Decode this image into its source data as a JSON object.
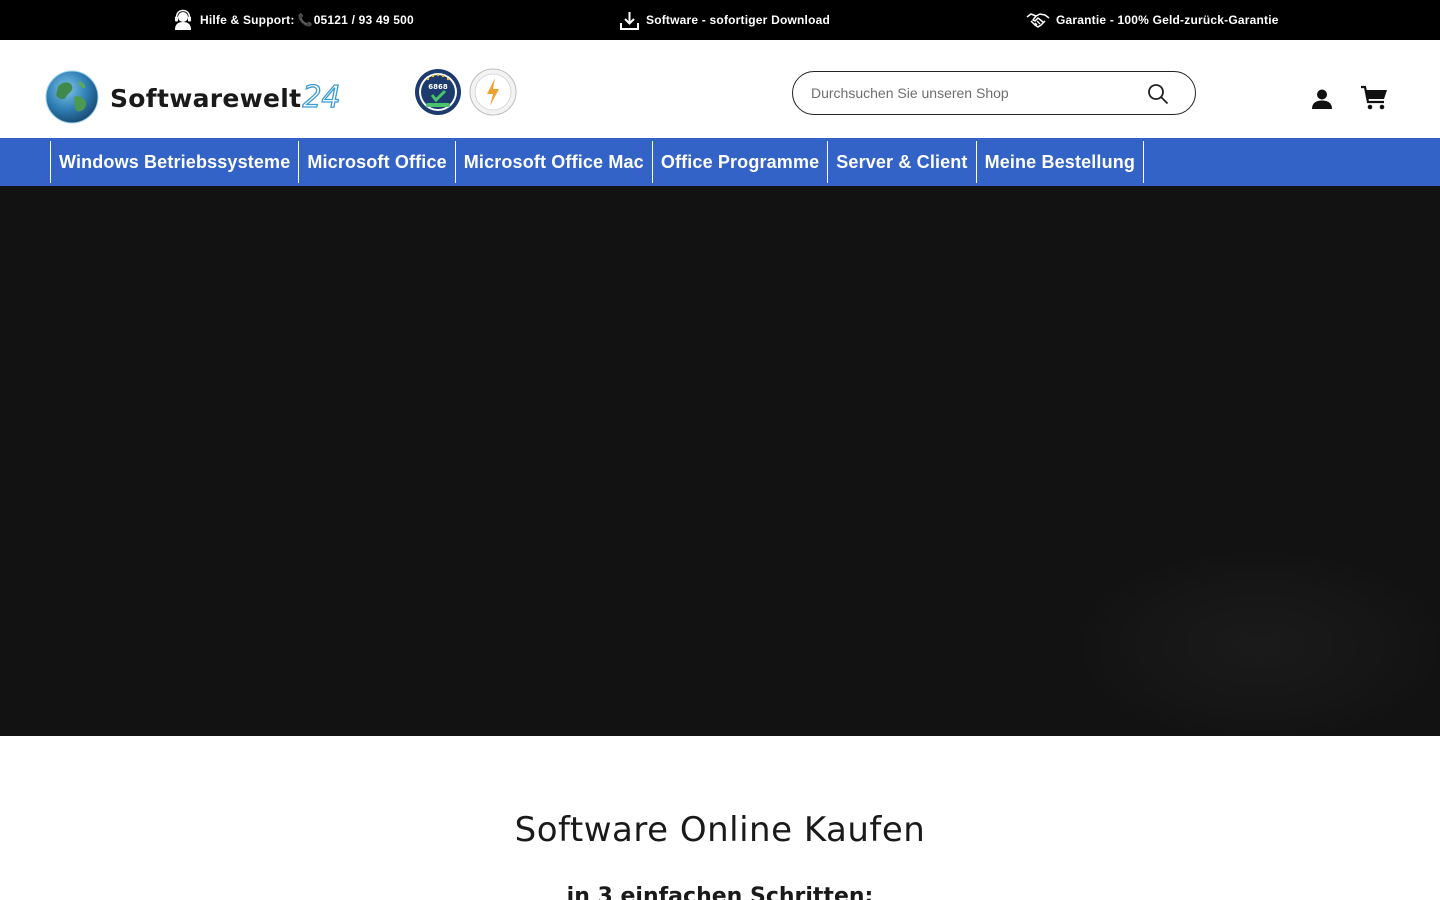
{
  "topbar": {
    "support_label": "Hilfe & Support:",
    "support_phone": "05121 / 93 49 500",
    "download_label": "Software - sofortiger Download",
    "guarantee_label": "Garantie - 100% Geld-zurück-Garantie"
  },
  "header": {
    "logo_text": "Softwarewelt",
    "logo_number": "24",
    "badge1_number": "6868",
    "search_placeholder": "Durchsuchen Sie unseren Shop"
  },
  "nav": {
    "items": [
      "Windows Betriebssysteme",
      "Microsoft Office",
      "Microsoft Office Mac",
      "Office Programme",
      "Server & Client",
      "Meine Bestellung"
    ]
  },
  "main": {
    "title": "Software Online Kaufen",
    "subtitle": "in 3 einfachen Schritten:"
  },
  "colors": {
    "topbar_bg": "#000000",
    "nav_bg": "#3363c7",
    "hero_bg": "#121212",
    "logo_accent": "#3a9bd6"
  },
  "icons": {
    "support": "headset-icon",
    "download": "download-icon",
    "guarantee": "handshake-icon",
    "search": "search-icon",
    "account": "user-icon",
    "cart": "cart-icon"
  }
}
